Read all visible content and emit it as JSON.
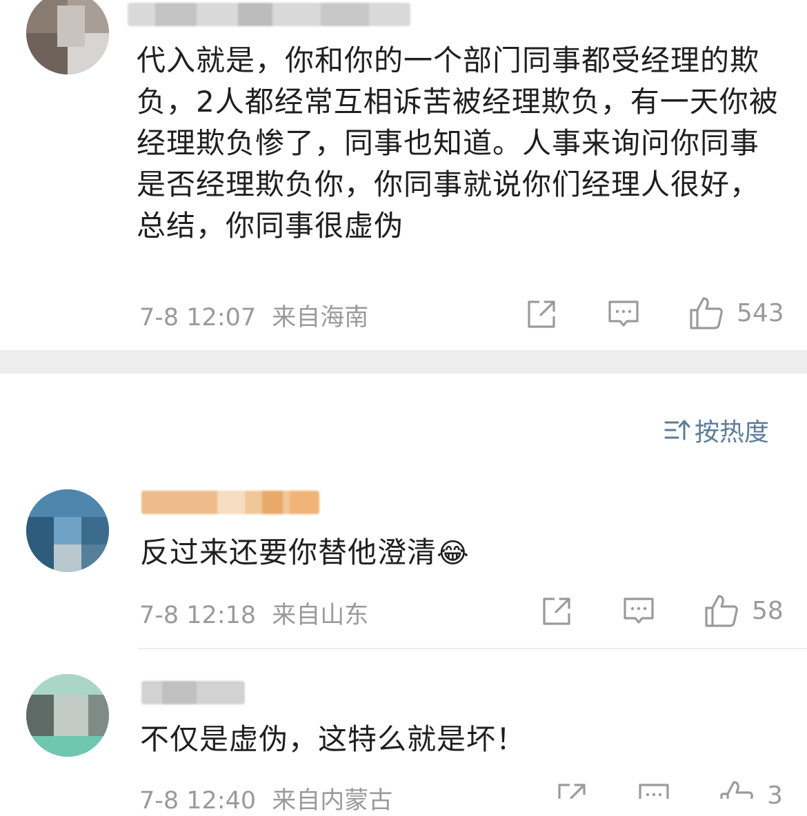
{
  "comments": [
    {
      "text": "代入就是，你和你的一个部门同事都受经理的欺负，2人都经常互相诉苦被经理欺负，有一天你被经理欺负惨了，同事也知道。人事来询问你同事是否经理欺负你，你同事就说你们经理人很好，总结，你同事很虚伪",
      "time": "7-8 12:07",
      "location": "来自海南",
      "likes": "543"
    },
    {
      "text": "反过来还要你替他澄清",
      "emoji": "😂",
      "time": "7-8 12:18",
      "location": "来自山东",
      "likes": "58"
    },
    {
      "text": "不仅是虚伪，这特么就是坏！",
      "time": "7-8 12:40",
      "location": "来自内蒙古",
      "likes": "3"
    }
  ],
  "sort": {
    "label": "按热度",
    "icon": "sort-icon"
  },
  "icons": {
    "share": "share-icon",
    "reply": "comment-icon",
    "like": "thumbs-up-icon"
  },
  "colors": {
    "link_blue": "#5b7c99",
    "meta_gray": "#9a9a9a",
    "band_gray": "#ededed"
  }
}
